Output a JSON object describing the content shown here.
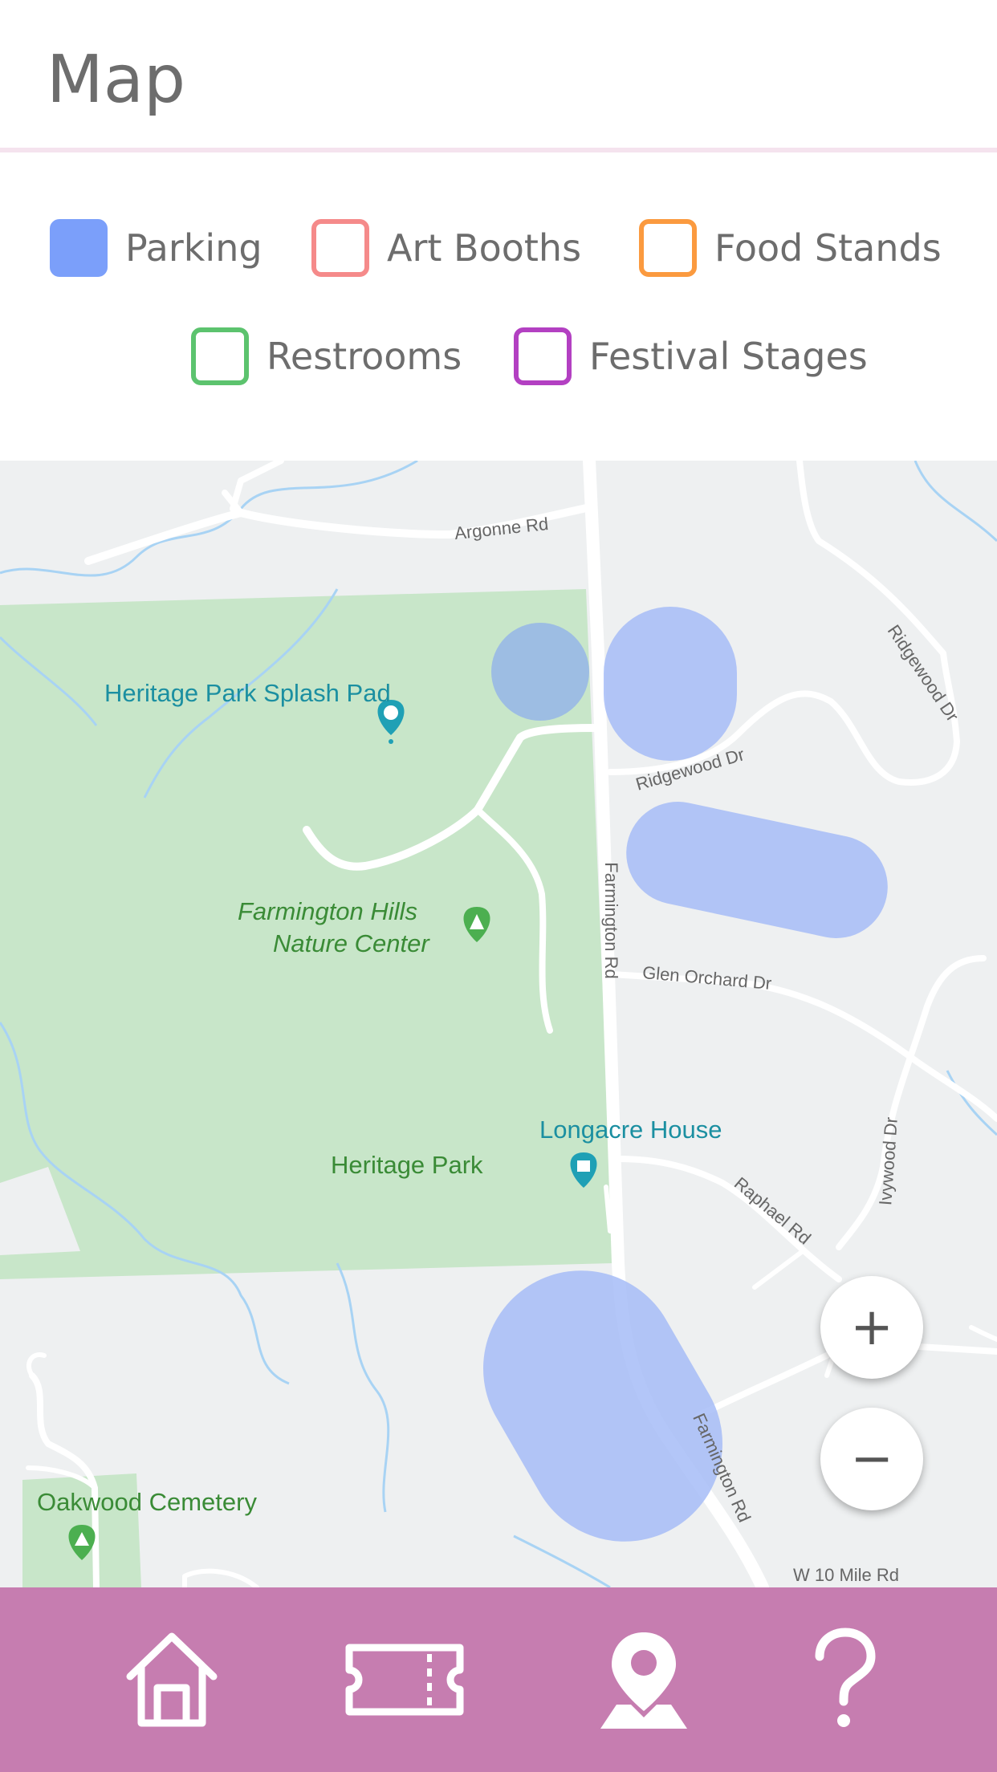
{
  "header": {
    "title": "Map"
  },
  "legend": {
    "items": [
      {
        "label": "Parking",
        "color": "#7b9ffa",
        "filled": true
      },
      {
        "label": "Art Booths",
        "color": "#f58a8a",
        "filled": false
      },
      {
        "label": "Food Stands",
        "color": "#fb9a3f",
        "filled": false
      },
      {
        "label": "Restrooms",
        "color": "#5cc36e",
        "filled": false
      },
      {
        "label": "Festival Stages",
        "color": "#b340c2",
        "filled": false
      }
    ]
  },
  "map": {
    "places": {
      "splash_pad": "Heritage Park Splash Pad",
      "nature_center_line1": "Farmington Hills",
      "nature_center_line2": "Nature Center",
      "longacre": "Longacre House",
      "heritage_park": "Heritage Park",
      "oakwood": "Oakwood Cemetery"
    },
    "roads": {
      "argonne": "Argonne Rd",
      "ridgewood_dr_1": "Ridgewood Dr",
      "ridgewood_dr_2": "Ridgewood Dr",
      "farmington_1": "Farmington Rd",
      "farmington_2": "Farmington Rd",
      "glen_orchard": "Glen Orchard Dr",
      "raphael": "Raphael Rd",
      "ivywood": "Ivywood Dr",
      "w10mile": "W 10 Mile Rd"
    },
    "zoom_in": "+",
    "zoom_out": "−",
    "parking_overlay_color": "#a6bcf7"
  },
  "tabbar": {
    "background": "#c67db0",
    "tabs": [
      {
        "icon": "home-icon"
      },
      {
        "icon": "ticket-icon"
      },
      {
        "icon": "map-pin-icon",
        "active": true
      },
      {
        "icon": "help-icon"
      }
    ]
  }
}
